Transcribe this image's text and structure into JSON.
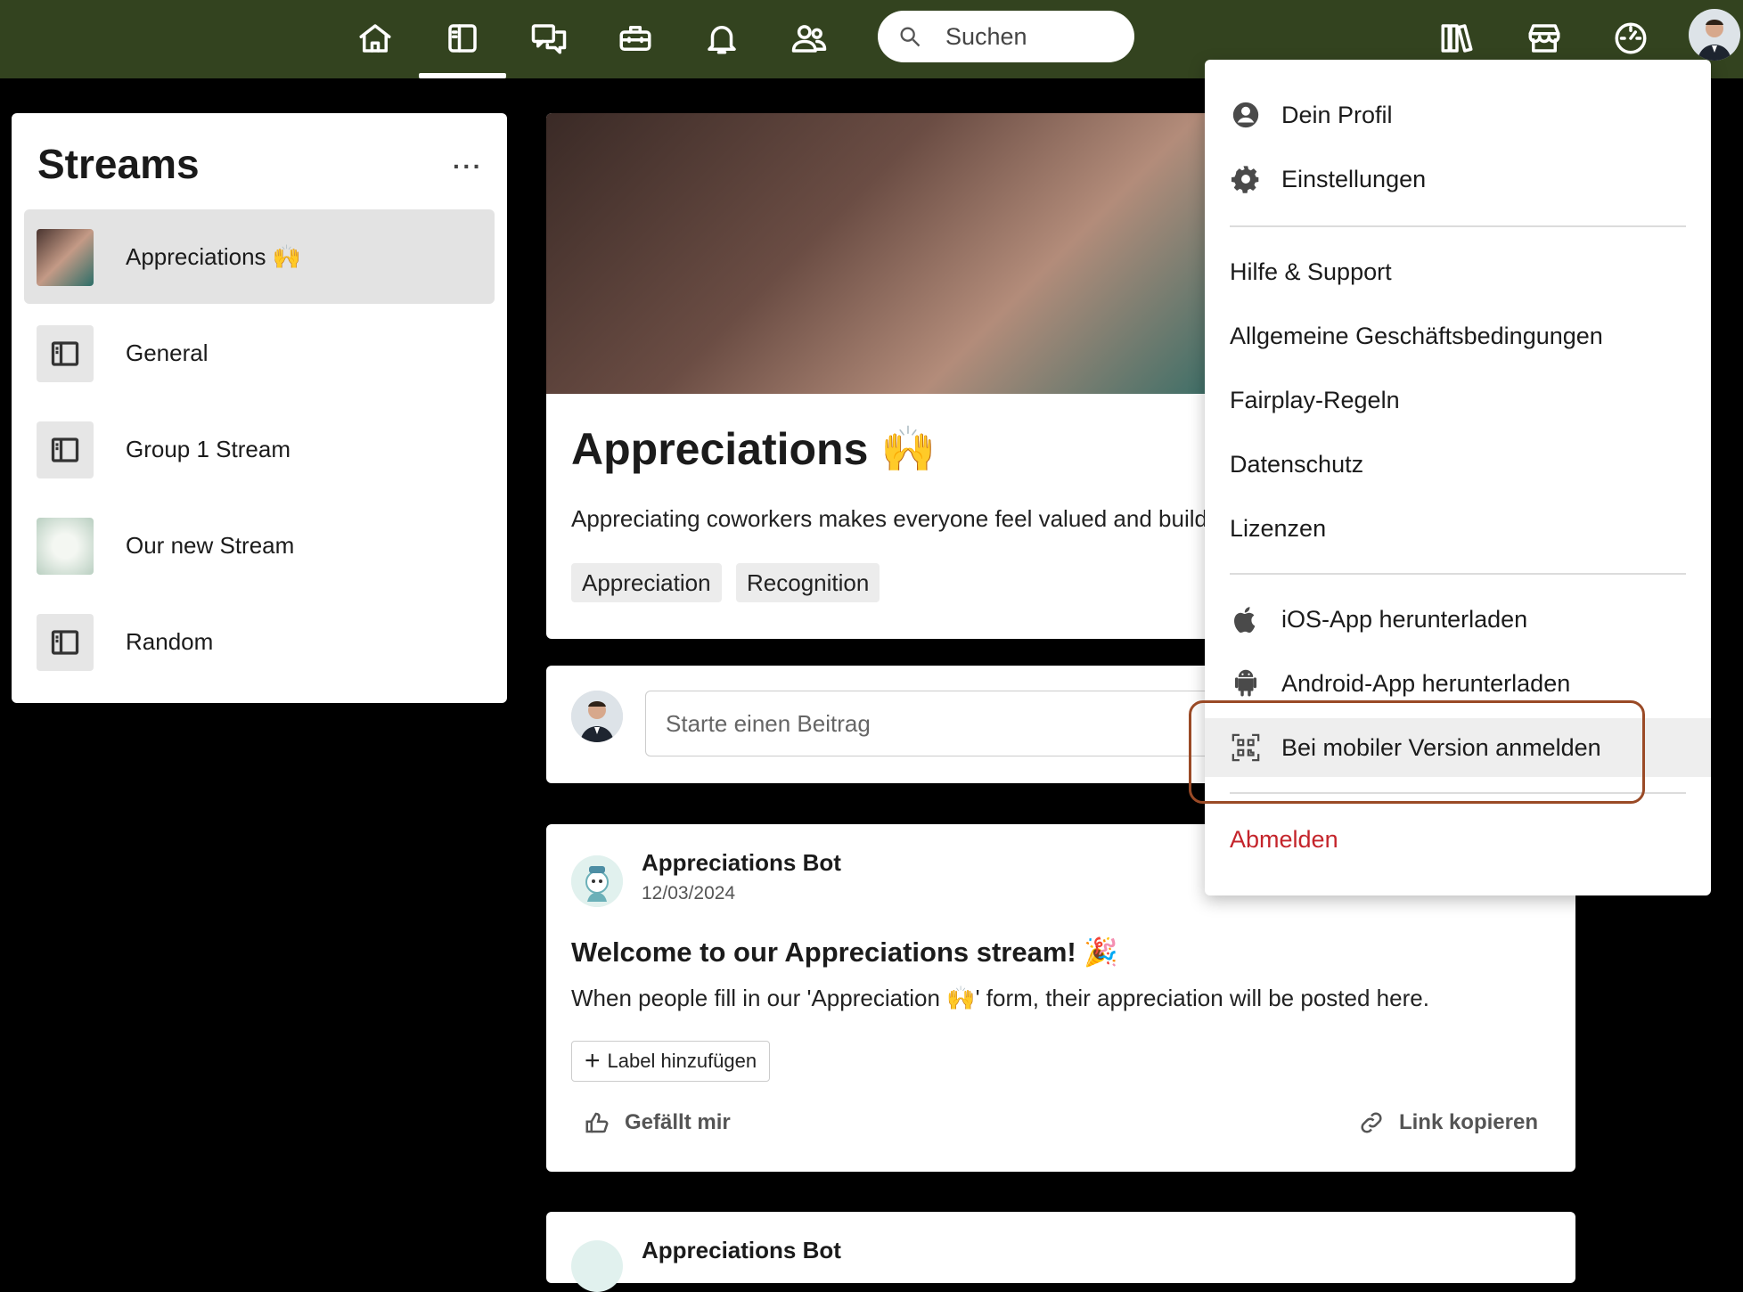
{
  "topbar": {
    "nav": [
      "home-icon",
      "streams-icon",
      "chat-icon",
      "toolbox-icon",
      "bell-icon",
      "people-icon"
    ],
    "search_placeholder": "Suchen",
    "right": [
      "library-icon",
      "store-icon",
      "dashboard-icon"
    ]
  },
  "streams": {
    "title": "Streams",
    "more": "···",
    "items": [
      {
        "label": "Appreciations 🙌"
      },
      {
        "label": "General"
      },
      {
        "label": "Group 1 Stream"
      },
      {
        "label": "Our new Stream"
      },
      {
        "label": "Random"
      }
    ]
  },
  "hero": {
    "title": "Appreciations 🙌",
    "description": "Appreciating coworkers makes everyone feel valued and builds",
    "tags": [
      "Appreciation",
      "Recognition"
    ]
  },
  "composer": {
    "placeholder": "Starte einen Beitrag"
  },
  "post": {
    "author": "Appreciations Bot",
    "date": "12/03/2024",
    "title": "Welcome to our Appreciations stream! 🎉",
    "body": "When people fill in our 'Appreciation 🙌' form, their appreciation will be posted here.",
    "label_button": "Label hinzufügen",
    "like": "Gefällt mir",
    "copy_link": "Link kopieren"
  },
  "post2": {
    "author": "Appreciations Bot"
  },
  "menu": {
    "profile": "Dein Profil",
    "settings": "Einstellungen",
    "help": "Hilfe & Support",
    "terms": "Allgemeine Geschäftsbedingungen",
    "fairplay": "Fairplay-Regeln",
    "privacy": "Datenschutz",
    "licenses": "Lizenzen",
    "ios": "iOS-App herunterladen",
    "android": "Android-App herunterladen",
    "mobile_login": "Bei mobiler Version anmelden",
    "logout": "Abmelden",
    "logout_color": "#c4242b"
  },
  "colors": {
    "topbar": "#33431f",
    "highlight_ring": "#9a4a26"
  }
}
